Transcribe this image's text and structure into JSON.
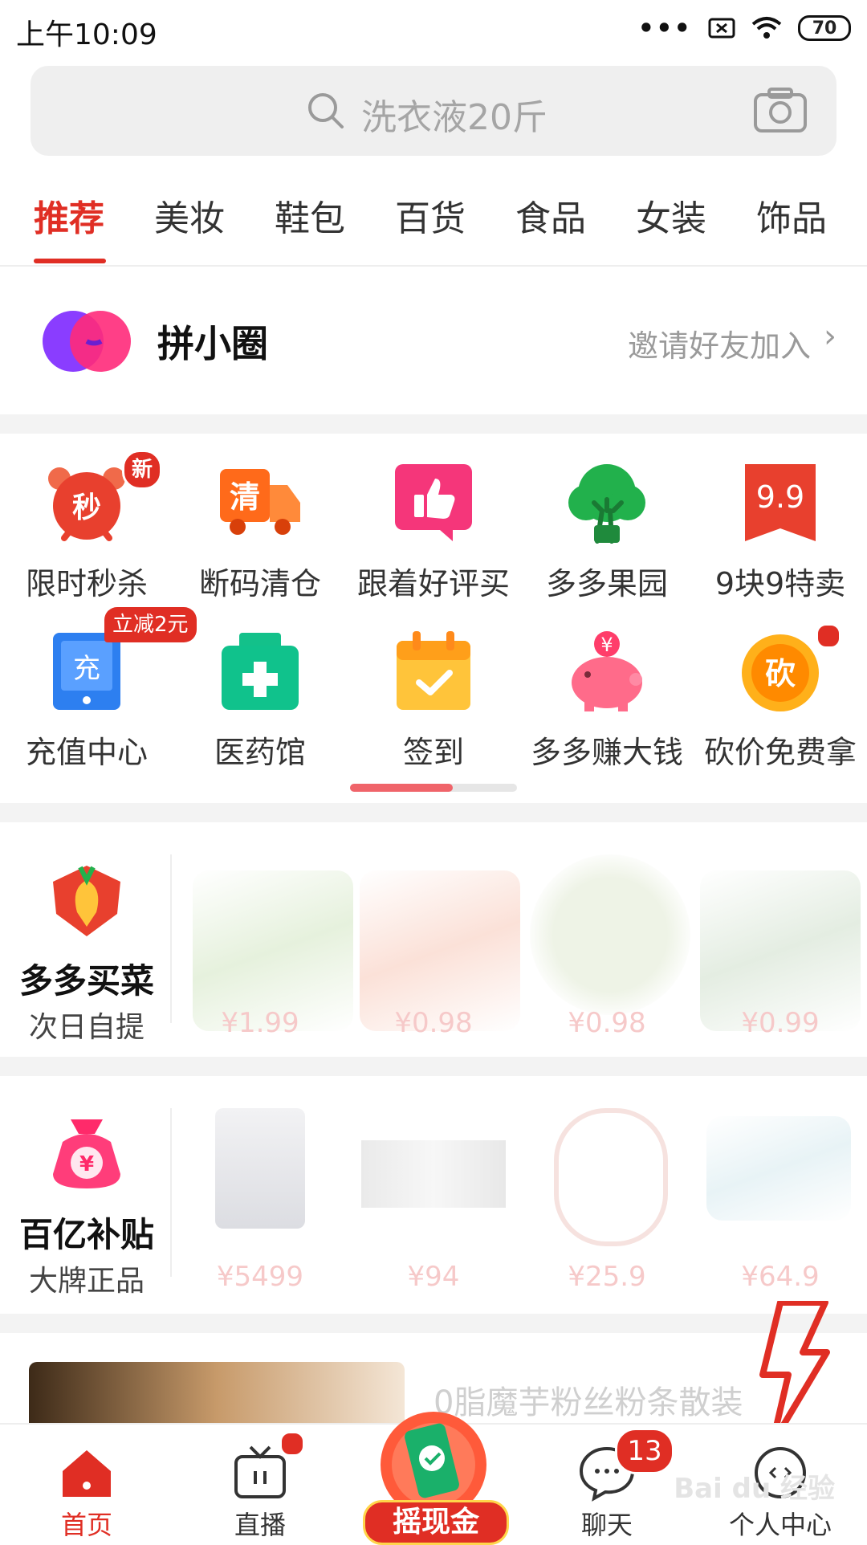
{
  "status_bar": {
    "time": "上午10:09",
    "dots": "•••",
    "battery": "70"
  },
  "search": {
    "placeholder": "洗衣液20斤"
  },
  "tabs": [
    {
      "label": "推荐",
      "active": true
    },
    {
      "label": "美妆"
    },
    {
      "label": "鞋包"
    },
    {
      "label": "百货"
    },
    {
      "label": "食品"
    },
    {
      "label": "女装"
    },
    {
      "label": "饰品"
    }
  ],
  "circle": {
    "title": "拼小圈",
    "invite": "邀请好友加入",
    "chevron": "›"
  },
  "grid": {
    "row1": [
      {
        "label": "限时秒杀",
        "icon": "alarm-clock-icon",
        "badge": "新",
        "glyph": "秒"
      },
      {
        "label": "断码清仓",
        "icon": "truck-icon",
        "glyph": "清"
      },
      {
        "label": "跟着好评买",
        "icon": "thumbs-up-icon"
      },
      {
        "label": "多多果园",
        "icon": "tree-icon"
      },
      {
        "label": "9块9特卖",
        "icon": "tag-99-icon",
        "glyph": "9.9"
      }
    ],
    "row2": [
      {
        "label": "充值中心",
        "icon": "phone-recharge-icon",
        "badge": "立减2元",
        "glyph": "充"
      },
      {
        "label": "医药馆",
        "icon": "medicine-box-icon"
      },
      {
        "label": "签到",
        "icon": "calendar-check-icon"
      },
      {
        "label": "多多赚大钱",
        "icon": "piggy-bank-icon",
        "glyph": "¥"
      },
      {
        "label": "砍价免费拿",
        "icon": "bargain-coin-icon",
        "glyph": "砍"
      }
    ]
  },
  "grocery": {
    "title": "多多买菜",
    "subtitle": "次日自提",
    "prices": [
      "¥1.99",
      "¥0.98",
      "¥0.98",
      "¥0.99"
    ]
  },
  "subsidy": {
    "title": "百亿补贴",
    "subtitle": "大牌正品",
    "yen": "¥",
    "prices": [
      "¥5499",
      "¥94",
      "¥25.9",
      "¥64.9"
    ]
  },
  "promo_text": "0脂魔芋粉丝粉条散装",
  "bottom_nav": [
    {
      "label": "首页",
      "active": true
    },
    {
      "label": "直播"
    },
    {
      "label": "摇现金"
    },
    {
      "label": "聊天",
      "badge": "13"
    },
    {
      "label": "个人中心"
    }
  ],
  "watermark": "Bai du 经验",
  "colors": {
    "brand": "#e02e24",
    "tab_active": "#e02e24",
    "background": "#ffffff"
  }
}
